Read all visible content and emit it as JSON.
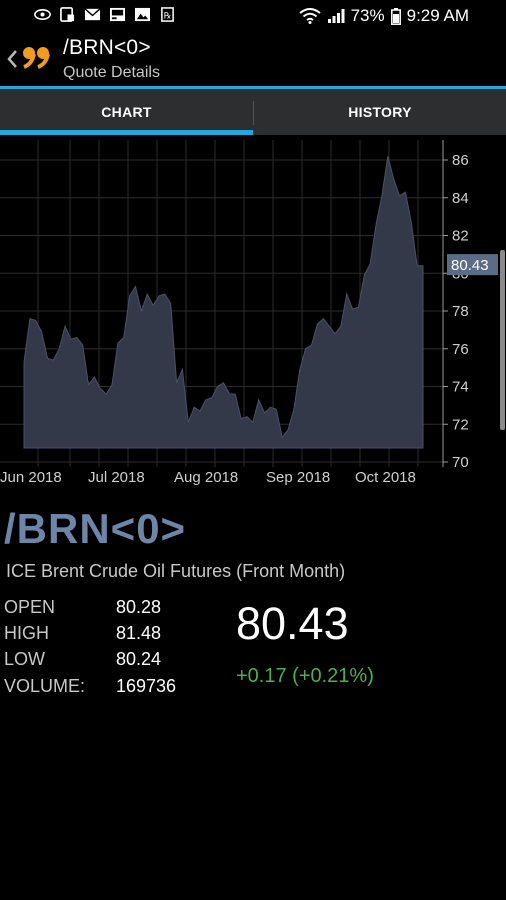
{
  "status": {
    "battery": "73%",
    "time": "9:29 AM",
    "left_icons": [
      "eye-icon",
      "lock-photo-icon",
      "mail-icon",
      "image-icon",
      "gallery-icon",
      "rx-icon"
    ],
    "right_icons": [
      "wifi-icon",
      "signal-icon"
    ]
  },
  "header": {
    "title": "/BRN<0>",
    "subtitle": "Quote Details"
  },
  "tabs": [
    {
      "label": "CHART",
      "active": true
    },
    {
      "label": "HISTORY",
      "active": false
    }
  ],
  "chart_data": {
    "type": "area",
    "x_tick_labels": [
      "Jun 2018",
      "Jul 2018",
      "Aug 2018",
      "Sep 2018",
      "Oct 2018"
    ],
    "y_tick_labels": [
      "70",
      "72",
      "74",
      "76",
      "78",
      "80",
      "82",
      "84",
      "86"
    ],
    "ylim": [
      70,
      86.5
    ],
    "last_value_label": "80.43",
    "values": [
      75.3,
      77.6,
      77.5,
      76.9,
      75.5,
      75.4,
      76.0,
      77.2,
      76.5,
      76.6,
      76.2,
      74.1,
      74.5,
      73.9,
      73.6,
      74.1,
      76.3,
      76.6,
      78.8,
      79.3,
      78.0,
      78.9,
      78.3,
      78.8,
      78.9,
      78.4,
      74.2,
      74.9,
      72.1,
      72.9,
      72.7,
      73.3,
      73.4,
      74.0,
      74.2,
      73.6,
      73.6,
      72.3,
      72.4,
      72.1,
      73.3,
      72.6,
      72.9,
      72.8,
      71.3,
      71.7,
      72.8,
      74.9,
      76.0,
      76.2,
      77.3,
      77.6,
      77.2,
      76.8,
      77.2,
      78.9,
      78.1,
      78.2,
      79.9,
      80.5,
      82.6,
      84.1,
      86.2,
      85.0,
      84.1,
      84.3,
      82.7,
      80.4,
      80.4
    ],
    "area_color": "#34394a",
    "grid": true
  },
  "quote": {
    "symbol": "/BRN<0>",
    "description": "ICE Brent Crude Oil Futures (Front Month)",
    "stats": [
      {
        "label": "OPEN",
        "value": "80.28"
      },
      {
        "label": "HIGH",
        "value": "81.48"
      },
      {
        "label": "LOW",
        "value": "80.24"
      },
      {
        "label": "VOLUME:",
        "value": "169736"
      }
    ],
    "last": "80.43",
    "change": "+0.17 (+0.21%)",
    "change_color": "#4caf50"
  }
}
